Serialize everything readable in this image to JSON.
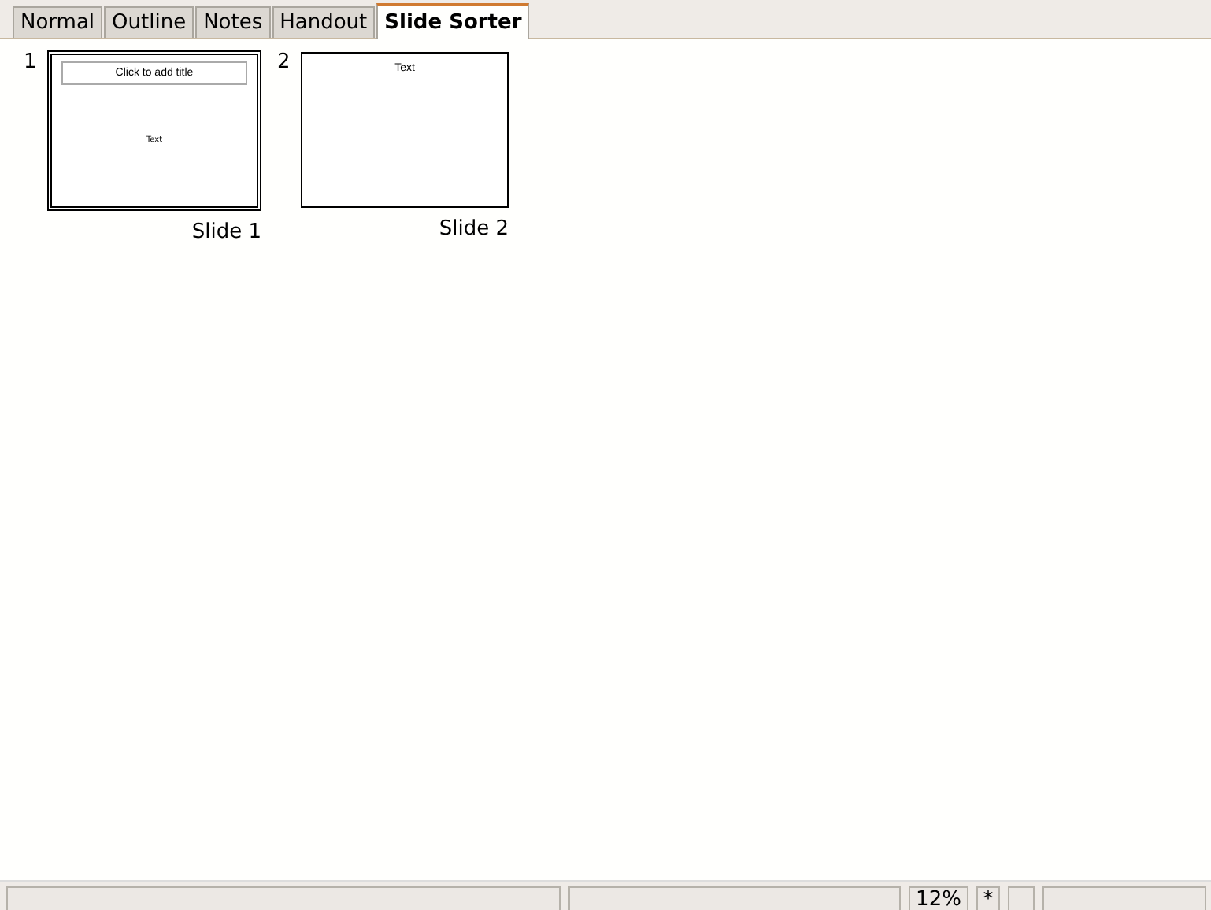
{
  "tabs": [
    {
      "label": "Normal",
      "selected": false
    },
    {
      "label": "Outline",
      "selected": false
    },
    {
      "label": "Notes",
      "selected": false
    },
    {
      "label": "Handout",
      "selected": false
    },
    {
      "label": "Slide Sorter",
      "selected": true
    }
  ],
  "slides": [
    {
      "number": "1",
      "name": "Slide 1",
      "selected": true,
      "title": "Click to add title",
      "title_placeholder": true,
      "body": "Text"
    },
    {
      "number": "2",
      "name": "Slide 2",
      "selected": false,
      "title": "Text",
      "title_placeholder": false
    }
  ],
  "status_bar": {
    "zoom": "12%",
    "modified": "*"
  }
}
